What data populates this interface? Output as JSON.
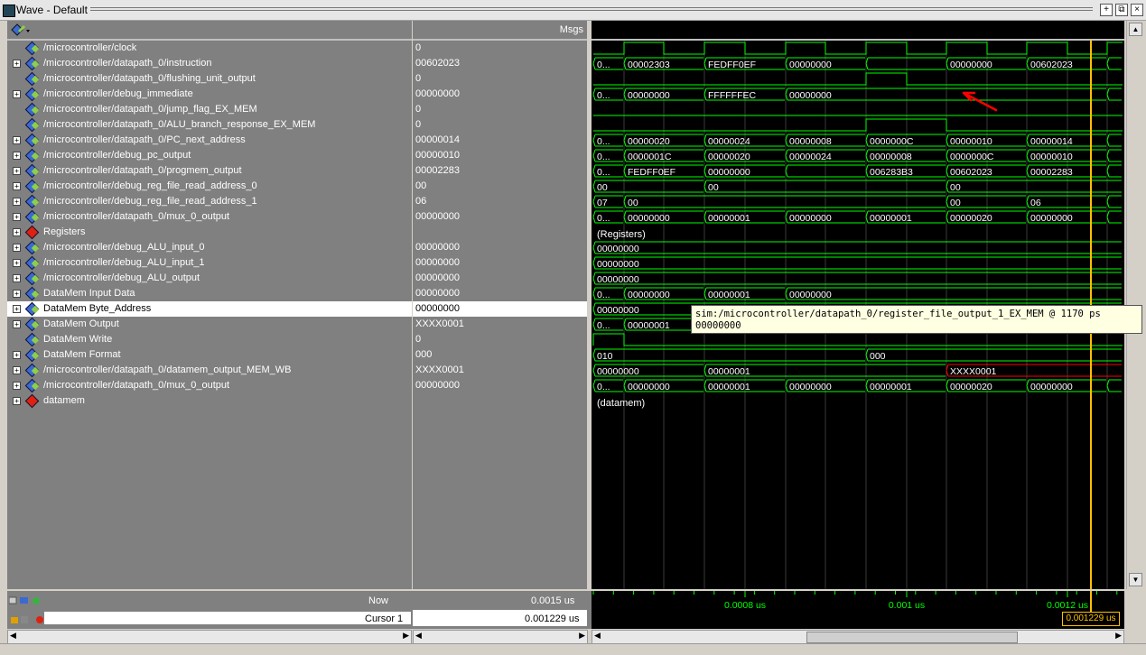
{
  "window": {
    "title": "Wave - Default"
  },
  "columns": {
    "values_header": "Msgs"
  },
  "signals": [
    {
      "name": "/microcontroller/clock",
      "value": "0",
      "expand": false,
      "icon": "signal-icon"
    },
    {
      "name": "/microcontroller/datapath_0/instruction",
      "value": "00602023",
      "expand": true,
      "icon": "signal-icon"
    },
    {
      "name": "/microcontroller/datapath_0/flushing_unit_output",
      "value": "0",
      "expand": false,
      "icon": "signal-icon"
    },
    {
      "name": "/microcontroller/debug_immediate",
      "value": "00000000",
      "expand": true,
      "icon": "signal-icon"
    },
    {
      "name": "/microcontroller/datapath_0/jump_flag_EX_MEM",
      "value": "0",
      "expand": false,
      "icon": "signal-icon"
    },
    {
      "name": "/microcontroller/datapath_0/ALU_branch_response_EX_MEM",
      "value": "0",
      "expand": false,
      "icon": "signal-icon"
    },
    {
      "name": "/microcontroller/datapath_0/PC_next_address",
      "value": "00000014",
      "expand": true,
      "icon": "signal-icon"
    },
    {
      "name": "/microcontroller/debug_pc_output",
      "value": "00000010",
      "expand": true,
      "icon": "signal-icon"
    },
    {
      "name": "/microcontroller/datapath_0/progmem_output",
      "value": "00002283",
      "expand": true,
      "icon": "signal-icon"
    },
    {
      "name": "/microcontroller/debug_reg_file_read_address_0",
      "value": "00",
      "expand": true,
      "icon": "signal-icon"
    },
    {
      "name": "/microcontroller/debug_reg_file_read_address_1",
      "value": "06",
      "expand": true,
      "icon": "signal-icon"
    },
    {
      "name": "/microcontroller/datapath_0/mux_0_output",
      "value": "00000000",
      "expand": true,
      "icon": "signal-icon"
    },
    {
      "name": "Registers",
      "value": "",
      "expand": true,
      "icon": "group-icon"
    },
    {
      "name": "/microcontroller/debug_ALU_input_0",
      "value": "00000000",
      "expand": true,
      "icon": "signal-icon"
    },
    {
      "name": "/microcontroller/debug_ALU_input_1",
      "value": "00000000",
      "expand": true,
      "icon": "signal-icon"
    },
    {
      "name": "/microcontroller/debug_ALU_output",
      "value": "00000000",
      "expand": true,
      "icon": "signal-icon"
    },
    {
      "name": "DataMem Input Data",
      "value": "00000000",
      "expand": true,
      "icon": "signal-icon"
    },
    {
      "name": "DataMem Byte_Address",
      "value": "00000000",
      "expand": true,
      "icon": "signal-icon",
      "selected": true
    },
    {
      "name": "DataMem Output",
      "value": "XXXX0001",
      "expand": true,
      "icon": "signal-icon"
    },
    {
      "name": "DataMem Write",
      "value": "0",
      "expand": false,
      "icon": "signal-icon"
    },
    {
      "name": "DataMem Format",
      "value": "000",
      "expand": true,
      "icon": "signal-icon"
    },
    {
      "name": "/microcontroller/datapath_0/datamem_output_MEM_WB",
      "value": "XXXX0001",
      "expand": true,
      "icon": "signal-icon"
    },
    {
      "name": "/microcontroller/datapath_0/mux_0_output",
      "value": "00000000",
      "expand": true,
      "icon": "signal-icon"
    },
    {
      "name": "datamem",
      "value": "",
      "expand": true,
      "icon": "group-icon"
    }
  ],
  "wave_rows": [
    {
      "type": "clock"
    },
    {
      "type": "bus",
      "segs": [
        [
          "0...",
          657
        ],
        [
          "00002303",
          691
        ],
        [
          "FEDFF0EF",
          780
        ],
        [
          "00000000",
          870
        ],
        [
          "",
          959
        ],
        [
          "00000000",
          1048
        ],
        [
          "00602023",
          1137
        ],
        [
          "",
          1226
        ]
      ]
    },
    {
      "type": "bit",
      "hi": [
        [
          959,
          1004
        ]
      ]
    },
    {
      "type": "bus",
      "segs": [
        [
          "0...",
          657
        ],
        [
          "00000000",
          691
        ],
        [
          "FFFFFFEC",
          780
        ],
        [
          "00000000",
          870
        ],
        [
          "",
          1226
        ]
      ]
    },
    {
      "type": "bit",
      "hi": []
    },
    {
      "type": "bit",
      "hi": [
        [
          959,
          1048
        ]
      ]
    },
    {
      "type": "bus",
      "segs": [
        [
          "0...",
          657
        ],
        [
          "00000020",
          691
        ],
        [
          "00000024",
          780
        ],
        [
          "00000008",
          870
        ],
        [
          "0000000C",
          959
        ],
        [
          "00000010",
          1048
        ],
        [
          "00000014",
          1137
        ],
        [
          "",
          1226
        ]
      ]
    },
    {
      "type": "bus",
      "segs": [
        [
          "0...",
          657
        ],
        [
          "0000001C",
          691
        ],
        [
          "00000020",
          780
        ],
        [
          "00000024",
          870
        ],
        [
          "00000008",
          959
        ],
        [
          "0000000C",
          1048
        ],
        [
          "00000010",
          1137
        ],
        [
          "",
          1226
        ]
      ]
    },
    {
      "type": "bus",
      "segs": [
        [
          "0...",
          657
        ],
        [
          "FEDFF0EF",
          691
        ],
        [
          "00000000",
          780
        ],
        [
          "",
          870
        ],
        [
          "006283B3",
          959
        ],
        [
          "00602023",
          1048
        ],
        [
          "00002283",
          1137
        ],
        [
          "",
          1226
        ]
      ]
    },
    {
      "type": "bus",
      "segs": [
        [
          "00",
          657
        ],
        [
          "00",
          780
        ],
        [
          "00",
          1048
        ]
      ]
    },
    {
      "type": "bus",
      "segs": [
        [
          "07",
          657
        ],
        [
          "00",
          691
        ],
        [
          "00",
          1048
        ],
        [
          "06",
          1137
        ],
        [
          "",
          1226
        ]
      ]
    },
    {
      "type": "bus",
      "segs": [
        [
          "0...",
          657
        ],
        [
          "00000000",
          691
        ],
        [
          "00000001",
          780
        ],
        [
          "00000000",
          870
        ],
        [
          "00000001",
          959
        ],
        [
          "00000020",
          1048
        ],
        [
          "00000000",
          1137
        ],
        [
          "",
          1226
        ]
      ]
    },
    {
      "type": "group",
      "label": "(Registers)"
    },
    {
      "type": "bus",
      "segs": [
        [
          "00000000",
          657
        ]
      ]
    },
    {
      "type": "bus",
      "segs": [
        [
          "00000000",
          657
        ]
      ]
    },
    {
      "type": "bus",
      "segs": [
        [
          "00000000",
          657
        ]
      ]
    },
    {
      "type": "bus",
      "segs": [
        [
          "0...",
          657
        ],
        [
          "00000000",
          691
        ],
        [
          "00000001",
          780
        ],
        [
          "00000000",
          870
        ]
      ]
    },
    {
      "type": "bus",
      "segs": [
        [
          "00000000",
          657
        ]
      ]
    },
    {
      "type": "bus",
      "segs": [
        [
          "0...",
          657
        ],
        [
          "00000001",
          691
        ]
      ]
    },
    {
      "type": "bit",
      "hi": [
        [
          657,
          691
        ]
      ]
    },
    {
      "type": "bus",
      "segs": [
        [
          "010",
          657
        ],
        [
          "000",
          959
        ]
      ]
    },
    {
      "type": "bus",
      "segs": [
        [
          "00000000",
          657
        ],
        [
          "00000001",
          780
        ],
        [
          "XXXX0001",
          1048,
          "red"
        ]
      ]
    },
    {
      "type": "bus",
      "segs": [
        [
          "0...",
          657
        ],
        [
          "00000000",
          691
        ],
        [
          "00000001",
          780
        ],
        [
          "00000000",
          870
        ],
        [
          "00000001",
          959
        ],
        [
          "00000020",
          1048
        ],
        [
          "00000000",
          1137
        ],
        [
          "",
          1226
        ]
      ]
    },
    {
      "type": "group",
      "label": "(datamem)"
    }
  ],
  "footer": {
    "now_label": "Now",
    "now_value": "0.0015 us",
    "cursor_label": "Cursor 1",
    "cursor_value": "0.001229 us",
    "timeline_labels": [
      "0.0008 us",
      "0.001 us",
      "0.0012 us"
    ],
    "cursor_flag": "0.001229 us"
  },
  "tooltip": {
    "line1": "sim:/microcontroller/datapath_0/register_file_output_1_EX_MEM @ 1170 ps",
    "line2": "00000000"
  },
  "colors": {
    "wave": "#00ff00",
    "cursor": "#ffc000",
    "unknown": "#ff0000",
    "annotation": "#ff0000"
  }
}
